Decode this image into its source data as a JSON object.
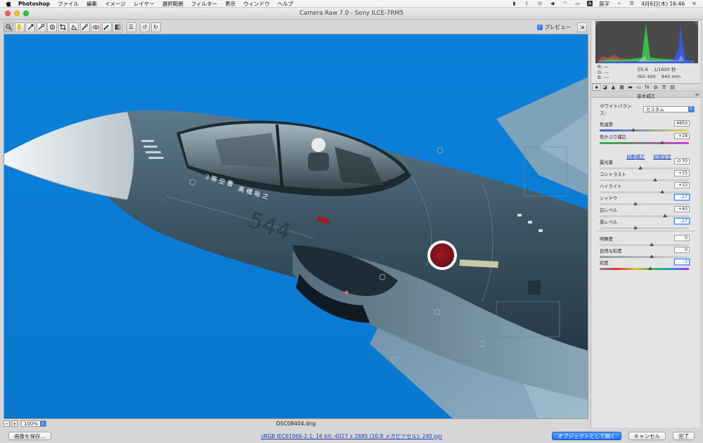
{
  "menubar": {
    "app": "Photoshop",
    "items": [
      "ファイル",
      "編集",
      "イメージ",
      "レイヤー",
      "選択範囲",
      "フィルター",
      "表示",
      "ウィンドウ",
      "ヘルプ"
    ],
    "input_method": "英字",
    "clock": "4月6日(木)  16:46"
  },
  "window": {
    "title": "Camera Raw 7.0  -  Sony ILCE-7RM5"
  },
  "toolbar": {
    "preview_label": "プレビュー",
    "tools": [
      "zoom-tool",
      "hand-tool",
      "white-balance-tool",
      "color-sampler-tool",
      "target-adjustment-tool",
      "crop-tool",
      "straighten-tool",
      "spot-removal-tool",
      "red-eye-tool",
      "adjustment-brush-tool",
      "graduated-filter-tool",
      "preferences",
      "rotate-left",
      "rotate-right"
    ]
  },
  "image": {
    "filename": "DSC08404.dng",
    "zoom": "100%",
    "aircraft_number": "544",
    "canopy_text_1": "3 等 空 曹",
    "canopy_text_2": "髙 橋 裕 之"
  },
  "readout": {
    "r": "R:  ---",
    "g": "G:  ---",
    "b": "B:  ---",
    "aperture": "f/5.6",
    "shutter": "1/1600 秒",
    "iso": "ISO 400",
    "focal": "840 mm"
  },
  "panel": {
    "title": "基本補正",
    "wb_label": "ホワイトバランス：",
    "wb_value": "カスタム",
    "auto_label": "自動補正",
    "default_label": "初期設定",
    "sliders": {
      "temperature": {
        "label": "色温度",
        "value": "4850",
        "pos": 0.38
      },
      "tint": {
        "label": "色かぶり補正",
        "value": "+18",
        "pos": 0.7
      },
      "exposure": {
        "label": "露光量",
        "value": "-0.70",
        "pos": 0.46
      },
      "contrast": {
        "label": "コントラスト",
        "value": "+15",
        "pos": 0.62
      },
      "highlights": {
        "label": "ハイライト",
        "value": "+33",
        "pos": 0.7
      },
      "shadows": {
        "label": "シャドウ",
        "value": "-27",
        "pos": 0.4
      },
      "whites": {
        "label": "白レベル",
        "value": "+40",
        "pos": 0.73
      },
      "blacks": {
        "label": "黒レベル",
        "value": "-27",
        "pos": 0.4
      },
      "clarity": {
        "label": "明瞭度",
        "value": "0",
        "pos": 0.58
      },
      "vibrance": {
        "label": "自然な彩度",
        "value": "0",
        "pos": 0.58
      },
      "saturation": {
        "label": "彩度",
        "value": "-3",
        "pos": 0.57
      }
    }
  },
  "footer": {
    "save_label": "画像を保存...",
    "workflow_link": "sRGB IEC61966-2.1; 16 bit; 4027 x 2685 (10.8 メガピクセル); 240 ppi",
    "open_object_label": "オブジェクトとして開く",
    "cancel_label": "キャンセル",
    "done_label": "完了"
  },
  "colors": {
    "sky": "#0a7fd8",
    "accent": "#1c6ef2",
    "hinomaru": "#8a1420"
  }
}
